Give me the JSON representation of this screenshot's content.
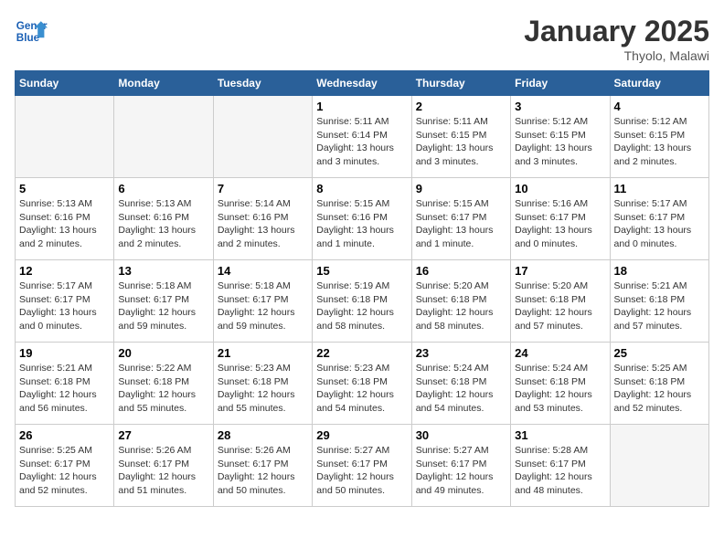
{
  "header": {
    "logo_text_general": "General",
    "logo_text_blue": "Blue",
    "month_title": "January 2025",
    "location": "Thyolo, Malawi"
  },
  "weekdays": [
    "Sunday",
    "Monday",
    "Tuesday",
    "Wednesday",
    "Thursday",
    "Friday",
    "Saturday"
  ],
  "weeks": [
    [
      {
        "num": "",
        "info": ""
      },
      {
        "num": "",
        "info": ""
      },
      {
        "num": "",
        "info": ""
      },
      {
        "num": "1",
        "info": "Sunrise: 5:11 AM\nSunset: 6:14 PM\nDaylight: 13 hours\nand 3 minutes."
      },
      {
        "num": "2",
        "info": "Sunrise: 5:11 AM\nSunset: 6:15 PM\nDaylight: 13 hours\nand 3 minutes."
      },
      {
        "num": "3",
        "info": "Sunrise: 5:12 AM\nSunset: 6:15 PM\nDaylight: 13 hours\nand 3 minutes."
      },
      {
        "num": "4",
        "info": "Sunrise: 5:12 AM\nSunset: 6:15 PM\nDaylight: 13 hours\nand 2 minutes."
      }
    ],
    [
      {
        "num": "5",
        "info": "Sunrise: 5:13 AM\nSunset: 6:16 PM\nDaylight: 13 hours\nand 2 minutes."
      },
      {
        "num": "6",
        "info": "Sunrise: 5:13 AM\nSunset: 6:16 PM\nDaylight: 13 hours\nand 2 minutes."
      },
      {
        "num": "7",
        "info": "Sunrise: 5:14 AM\nSunset: 6:16 PM\nDaylight: 13 hours\nand 2 minutes."
      },
      {
        "num": "8",
        "info": "Sunrise: 5:15 AM\nSunset: 6:16 PM\nDaylight: 13 hours\nand 1 minute."
      },
      {
        "num": "9",
        "info": "Sunrise: 5:15 AM\nSunset: 6:17 PM\nDaylight: 13 hours\nand 1 minute."
      },
      {
        "num": "10",
        "info": "Sunrise: 5:16 AM\nSunset: 6:17 PM\nDaylight: 13 hours\nand 0 minutes."
      },
      {
        "num": "11",
        "info": "Sunrise: 5:17 AM\nSunset: 6:17 PM\nDaylight: 13 hours\nand 0 minutes."
      }
    ],
    [
      {
        "num": "12",
        "info": "Sunrise: 5:17 AM\nSunset: 6:17 PM\nDaylight: 13 hours\nand 0 minutes."
      },
      {
        "num": "13",
        "info": "Sunrise: 5:18 AM\nSunset: 6:17 PM\nDaylight: 12 hours\nand 59 minutes."
      },
      {
        "num": "14",
        "info": "Sunrise: 5:18 AM\nSunset: 6:17 PM\nDaylight: 12 hours\nand 59 minutes."
      },
      {
        "num": "15",
        "info": "Sunrise: 5:19 AM\nSunset: 6:18 PM\nDaylight: 12 hours\nand 58 minutes."
      },
      {
        "num": "16",
        "info": "Sunrise: 5:20 AM\nSunset: 6:18 PM\nDaylight: 12 hours\nand 58 minutes."
      },
      {
        "num": "17",
        "info": "Sunrise: 5:20 AM\nSunset: 6:18 PM\nDaylight: 12 hours\nand 57 minutes."
      },
      {
        "num": "18",
        "info": "Sunrise: 5:21 AM\nSunset: 6:18 PM\nDaylight: 12 hours\nand 57 minutes."
      }
    ],
    [
      {
        "num": "19",
        "info": "Sunrise: 5:21 AM\nSunset: 6:18 PM\nDaylight: 12 hours\nand 56 minutes."
      },
      {
        "num": "20",
        "info": "Sunrise: 5:22 AM\nSunset: 6:18 PM\nDaylight: 12 hours\nand 55 minutes."
      },
      {
        "num": "21",
        "info": "Sunrise: 5:23 AM\nSunset: 6:18 PM\nDaylight: 12 hours\nand 55 minutes."
      },
      {
        "num": "22",
        "info": "Sunrise: 5:23 AM\nSunset: 6:18 PM\nDaylight: 12 hours\nand 54 minutes."
      },
      {
        "num": "23",
        "info": "Sunrise: 5:24 AM\nSunset: 6:18 PM\nDaylight: 12 hours\nand 54 minutes."
      },
      {
        "num": "24",
        "info": "Sunrise: 5:24 AM\nSunset: 6:18 PM\nDaylight: 12 hours\nand 53 minutes."
      },
      {
        "num": "25",
        "info": "Sunrise: 5:25 AM\nSunset: 6:18 PM\nDaylight: 12 hours\nand 52 minutes."
      }
    ],
    [
      {
        "num": "26",
        "info": "Sunrise: 5:25 AM\nSunset: 6:17 PM\nDaylight: 12 hours\nand 52 minutes."
      },
      {
        "num": "27",
        "info": "Sunrise: 5:26 AM\nSunset: 6:17 PM\nDaylight: 12 hours\nand 51 minutes."
      },
      {
        "num": "28",
        "info": "Sunrise: 5:26 AM\nSunset: 6:17 PM\nDaylight: 12 hours\nand 50 minutes."
      },
      {
        "num": "29",
        "info": "Sunrise: 5:27 AM\nSunset: 6:17 PM\nDaylight: 12 hours\nand 50 minutes."
      },
      {
        "num": "30",
        "info": "Sunrise: 5:27 AM\nSunset: 6:17 PM\nDaylight: 12 hours\nand 49 minutes."
      },
      {
        "num": "31",
        "info": "Sunrise: 5:28 AM\nSunset: 6:17 PM\nDaylight: 12 hours\nand 48 minutes."
      },
      {
        "num": "",
        "info": ""
      }
    ]
  ]
}
